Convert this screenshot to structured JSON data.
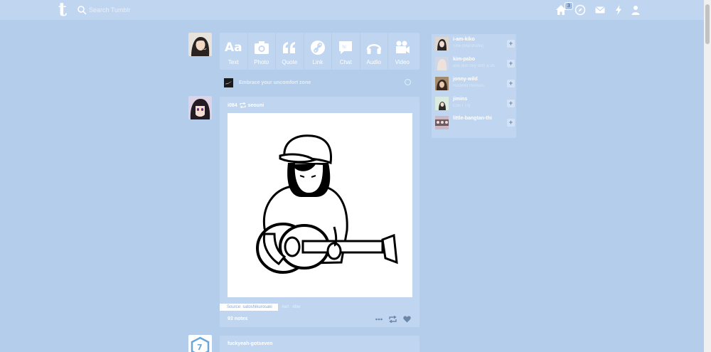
{
  "header": {
    "search_placeholder": "Search Tumblr",
    "home_badge": "3"
  },
  "composer": {
    "types": [
      {
        "label": "Text",
        "icon": "text-icon"
      },
      {
        "label": "Photo",
        "icon": "camera-icon"
      },
      {
        "label": "Quote",
        "icon": "quote-icon"
      },
      {
        "label": "Link",
        "icon": "link-icon"
      },
      {
        "label": "Chat",
        "icon": "chat-icon"
      },
      {
        "label": "Audio",
        "icon": "headphones-icon"
      },
      {
        "label": "Video",
        "icon": "video-camera-icon"
      }
    ]
  },
  "promo": {
    "text": "Embrace your uncomfort zone"
  },
  "post": {
    "author": "i084",
    "reblogged_from": "seouni",
    "source_label": "Source: satoshikurosaki",
    "tags": [
      "#art",
      "#bw"
    ],
    "notes": "93 notes"
  },
  "post2": {
    "author": "fuckyeah-gotseven"
  },
  "recommendations": [
    {
      "name": "i-am-kiko",
      "sub": "Title (Marshaha)"
    },
    {
      "name": "kim-pabo",
      "sub": "ano ano hey with a uh"
    },
    {
      "name": "jonny-wild",
      "sub": "Rodwild Henson"
    },
    {
      "name": "jimins",
      "sub": "Can I Try"
    },
    {
      "name": "little-bangtan-thi",
      "sub": ""
    }
  ],
  "colors": {
    "background": "#b3cdeb",
    "panel": "#c0d6f0",
    "text": "#ffffff"
  }
}
